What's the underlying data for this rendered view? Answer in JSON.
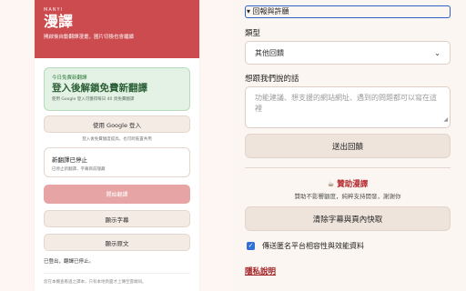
{
  "popup": {
    "brand_small": "MANYI",
    "brand_title": "漫譯",
    "tagline": "開啟後自動翻譯漫畫，圖片切換也會繼續",
    "promo": {
      "eyebrow": "今日免費新翻譯",
      "headline": "登入後解鎖免費新翻譯",
      "note": "使用 Google 登入可獲得每日 40 頁免費翻譯"
    },
    "google_login_label": "使用 Google 登入",
    "login_note": "登入後免費額度提高，也可跨裝置共用",
    "status_card": {
      "title": "新翻譯已停止",
      "subtitle": "已停止新翻譯，字幕目前隱藏"
    },
    "start_label": "開始翻譯",
    "show_subtitles_label": "顯示字幕",
    "show_original_label": "顯示原文",
    "status_text": "已登出，翻譯已停止。",
    "footer_note": "您在本機查看過之譯本，只有本地頁面才上傳至雲端伺。"
  },
  "feedback": {
    "summary_label": "▾ 回報與許願",
    "type_label": "類型",
    "type_value": "其他回饋",
    "message_label": "想跟我們說的話",
    "message_placeholder": "功能建議、想支援的網站網址、遇到的問題都可以寫在這裡",
    "submit_label": "送出回饋",
    "sponsor_icon": "☕",
    "sponsor_label": "贊助漫譯",
    "sponsor_sub": "贊助不影響額度，純粹支持開發，謝謝你",
    "clear_label": "清除字幕與頁內快取",
    "telemetry_label": "傳送匿名平台相容性與效能資料",
    "telemetry_checked": true,
    "privacy_label": "隱私說明"
  },
  "colors": {
    "brand_red": "#cb4b4f",
    "promo_green": "#e3f2e5",
    "primary_disabled": "#e6a4a4",
    "link_red": "#a31e22",
    "focus_blue": "#2f5fc7"
  }
}
